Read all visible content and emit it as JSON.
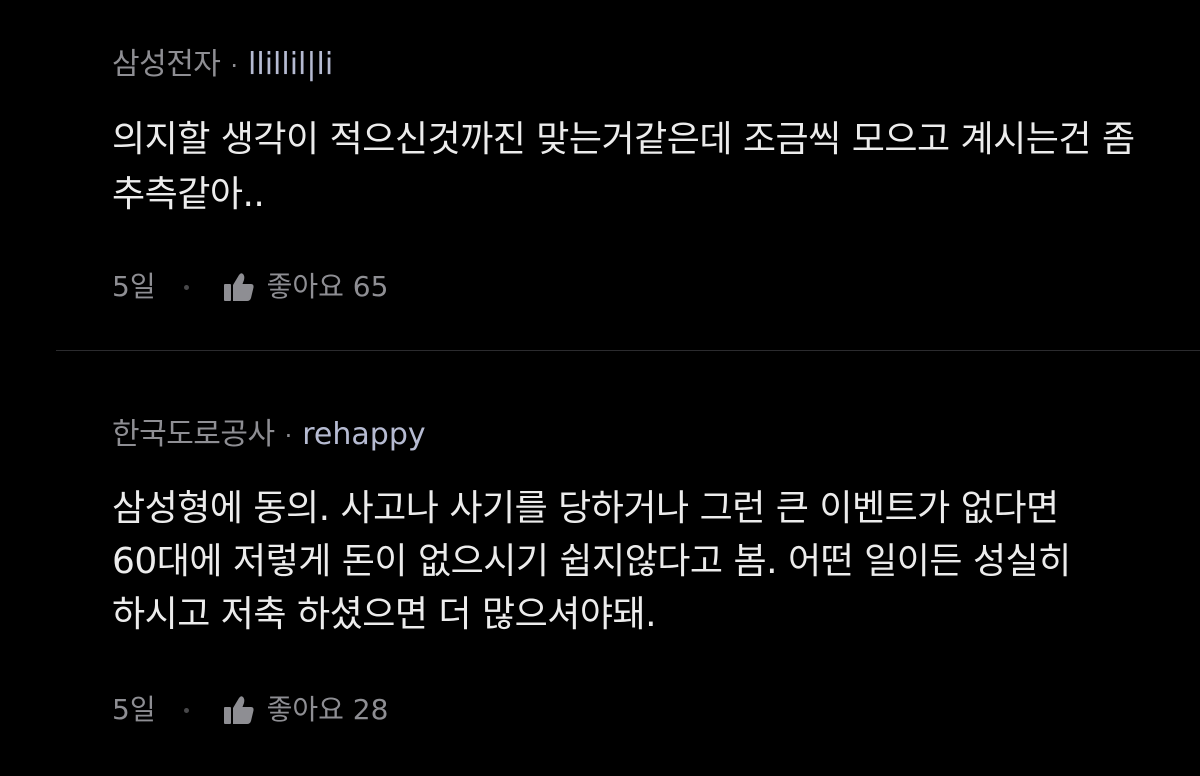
{
  "comments": [
    {
      "company": "삼성전자",
      "separator": "·",
      "nickname": "llillil|li",
      "text": "의지할 생각이 적으신것까진 맞는거같은데 조금씩 모으고 계시는건 좀 추측같아..",
      "time": "5일",
      "like_label": "좋아요",
      "like_count": "65"
    },
    {
      "company": "한국도로공사",
      "separator": "·",
      "nickname": "rehappy",
      "text": "삼성형에 동의. 사고나 사기를 당하거나 그런 큰 이벤트가 없다면 60대에 저렇게 돈이 없으시기 쉽지않다고 봄. 어떤 일이든 성실히 하시고 저축 하셨으면 더 많으셔야돼.",
      "time": "5일",
      "like_label": "좋아요",
      "like_count": "28"
    }
  ],
  "icons": {
    "like": "thumbs-up-icon"
  },
  "colors": {
    "background": "#000000",
    "company_text": "#8e8e93",
    "nickname_text": "#b6bbd2",
    "body_text": "#ececec",
    "divider": "#2b2b2e"
  }
}
